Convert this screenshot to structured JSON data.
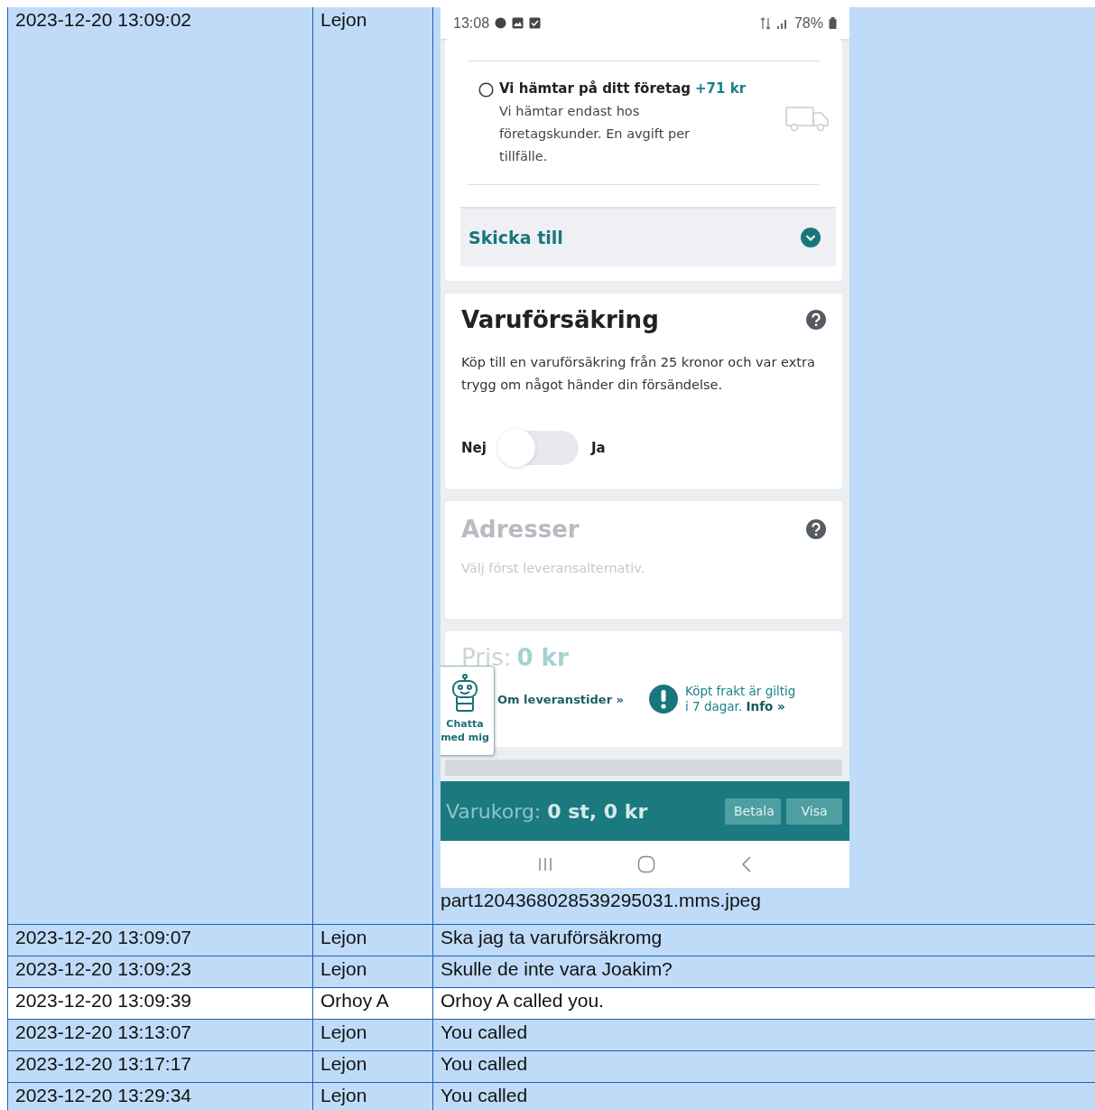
{
  "table": {
    "rows": [
      {
        "time": "2023-12-20 13:09:02",
        "sender": "Lejon",
        "kind": "sent",
        "attachment": {
          "caption": "part1204368028539295031.mms.jpeg",
          "screenshot": {
            "status_bar": {
              "time": "13:08",
              "battery": "78%"
            },
            "delivery_option": {
              "title": "Vi hämtar på ditt företag",
              "price": "+71 kr",
              "description": "Vi hämtar endast hos företagskunder. En avgift per tillfälle.",
              "selected": false
            },
            "ship_to": {
              "label": "Skicka till"
            },
            "insurance": {
              "title": "Varuförsäkring",
              "description": "Köp till en varuförsäkring från 25 kronor och var extra trygg om något händer din försändelse.",
              "off_label": "Nej",
              "on_label": "Ja",
              "on": false
            },
            "addresses": {
              "title": "Adresser",
              "hint": "Välj först leveransalternativ."
            },
            "price": {
              "label": "Pris:",
              "value": "0 kr",
              "delivery_link": "Om leveranstider »",
              "notice": "Köpt frakt är giltig i 7 dagar.",
              "notice_link": "Info »"
            },
            "chat_button": {
              "label": "Chatta med mig"
            },
            "cart": {
              "label": "Varukorg:",
              "summary": "0 st, 0 kr",
              "buttons": [
                "Betala",
                "Visa"
              ]
            }
          }
        }
      },
      {
        "time": "2023-12-20 13:09:07",
        "sender": "Lejon",
        "kind": "sent",
        "message": "Ska jag ta varuförsäkromg"
      },
      {
        "time": "2023-12-20 13:09:23",
        "sender": "Lejon",
        "kind": "sent",
        "message": "Skulle de inte vara Joakim?"
      },
      {
        "time": "2023-12-20 13:09:39",
        "sender": "Orhoy A",
        "kind": "received",
        "message": "Orhoy A called you."
      },
      {
        "time": "2023-12-20 13:13:07",
        "sender": "Lejon",
        "kind": "sent",
        "message": "You called"
      },
      {
        "time": "2023-12-20 13:17:17",
        "sender": "Lejon",
        "kind": "sent",
        "message": "You called"
      },
      {
        "time": "2023-12-20 13:29:34",
        "sender": "Lejon",
        "kind": "sent",
        "message": "You called"
      }
    ]
  }
}
